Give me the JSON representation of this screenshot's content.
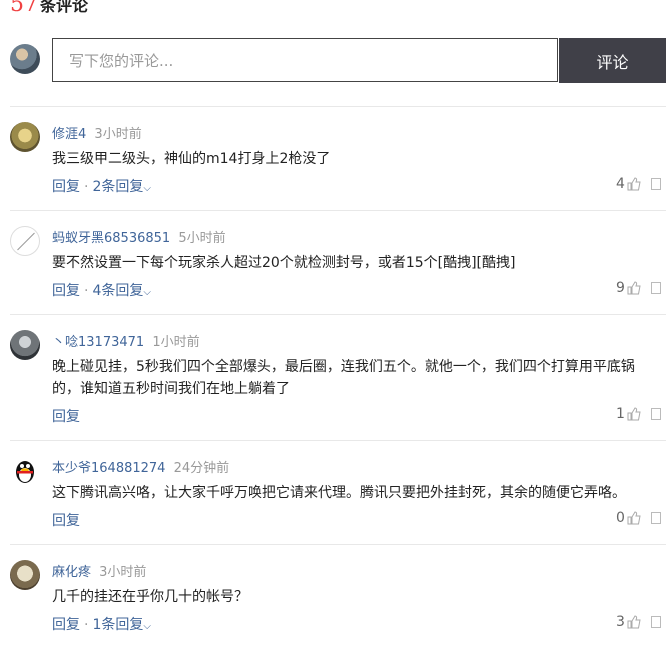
{
  "header": {
    "count": "57",
    "count_label": "条评论"
  },
  "compose": {
    "placeholder": "写下您的评论...",
    "submit_label": "评论"
  },
  "comments": [
    {
      "name": "修涯4",
      "time": "3小时前",
      "text": "我三级甲二级头，神仙的m14打身上2枪没了",
      "reply_label": "回复",
      "replies_label": "2条回复",
      "likes": "4"
    },
    {
      "name": "蚂蚁牙黑68536851",
      "time": "5小时前",
      "text": "要不然设置一下每个玩家杀人超过20个就检测封号，或者15个[酷拽][酷拽]",
      "reply_label": "回复",
      "replies_label": "4条回复",
      "likes": "9"
    },
    {
      "name": "丶唸13173471",
      "time": "1小时前",
      "text": "晚上碰见挂，5秒我们四个全部爆头，最后圈，连我们五个。就他一个，我们四个打算用平底锅的，谁知道五秒时间我们在地上躺着了",
      "reply_label": "回复",
      "replies_label": "",
      "likes": "1"
    },
    {
      "name": "本少爷164881274",
      "time": "24分钟前",
      "text": "这下腾讯高兴咯，让大家千呼万唤把它请来代理。腾讯只要把外挂封死，其余的随便它弄咯。",
      "reply_label": "回复",
      "replies_label": "",
      "likes": "0"
    },
    {
      "name": "麻化疼",
      "time": "3小时前",
      "text": "几千的挂还在乎你几十的帐号？",
      "reply_label": "回复",
      "replies_label": "1条回复",
      "likes": "3"
    }
  ],
  "colors": {
    "accent": "#f04142",
    "link": "#406599",
    "button_bg": "#404048"
  }
}
